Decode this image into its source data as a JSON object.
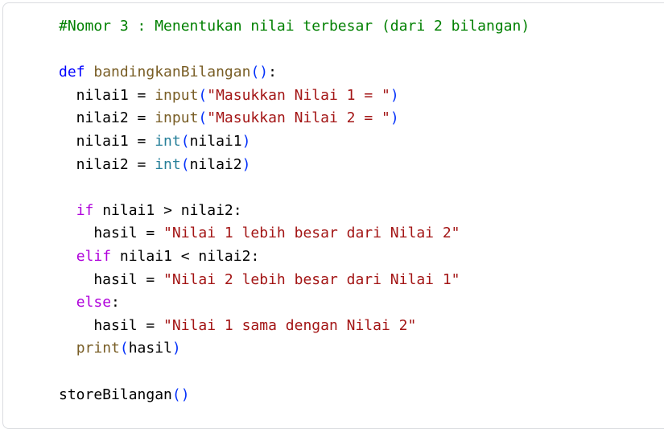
{
  "colors": {
    "comment": "#008000",
    "keyword_def": "#0000ff",
    "keyword_control": "#af00db",
    "function": "#795e26",
    "builtin_type": "#267f99",
    "string": "#a31515",
    "bracket": "#0431fa",
    "text": "#000000",
    "panel_border": "#dadce0"
  },
  "code": {
    "language": "python",
    "lines": [
      {
        "tokens": [
          {
            "t": "#Nomor 3 : Menentukan nilai terbesar (dari 2 bilangan)",
            "k": "comment"
          }
        ]
      },
      {
        "tokens": []
      },
      {
        "tokens": [
          {
            "t": "def",
            "k": "kw1"
          },
          {
            "t": " ",
            "k": "op"
          },
          {
            "t": "bandingkanBilangan",
            "k": "fn"
          },
          {
            "t": "()",
            "k": "br"
          },
          {
            "t": ":",
            "k": "op"
          }
        ]
      },
      {
        "tokens": [
          {
            "t": "  nilai1 = ",
            "k": "op"
          },
          {
            "t": "input",
            "k": "fn"
          },
          {
            "t": "(",
            "k": "br"
          },
          {
            "t": "\"Masukkan Nilai 1 = \"",
            "k": "str"
          },
          {
            "t": ")",
            "k": "br"
          }
        ]
      },
      {
        "tokens": [
          {
            "t": "  nilai2 = ",
            "k": "op"
          },
          {
            "t": "input",
            "k": "fn"
          },
          {
            "t": "(",
            "k": "br"
          },
          {
            "t": "\"Masukkan Nilai 2 = \"",
            "k": "str"
          },
          {
            "t": ")",
            "k": "br"
          }
        ]
      },
      {
        "tokens": [
          {
            "t": "  nilai1 = ",
            "k": "op"
          },
          {
            "t": "int",
            "k": "bi"
          },
          {
            "t": "(",
            "k": "br"
          },
          {
            "t": "nilai1",
            "k": "op"
          },
          {
            "t": ")",
            "k": "br"
          }
        ]
      },
      {
        "tokens": [
          {
            "t": "  nilai2 = ",
            "k": "op"
          },
          {
            "t": "int",
            "k": "bi"
          },
          {
            "t": "(",
            "k": "br"
          },
          {
            "t": "nilai2",
            "k": "op"
          },
          {
            "t": ")",
            "k": "br"
          }
        ]
      },
      {
        "tokens": []
      },
      {
        "tokens": [
          {
            "t": "  ",
            "k": "op"
          },
          {
            "t": "if",
            "k": "kw2"
          },
          {
            "t": " nilai1 > nilai2:",
            "k": "op"
          }
        ]
      },
      {
        "tokens": [
          {
            "t": "    hasil = ",
            "k": "op"
          },
          {
            "t": "\"Nilai 1 lebih besar dari Nilai 2\"",
            "k": "str"
          }
        ]
      },
      {
        "tokens": [
          {
            "t": "  ",
            "k": "op"
          },
          {
            "t": "elif",
            "k": "kw2"
          },
          {
            "t": " nilai1 < nilai2:",
            "k": "op"
          }
        ]
      },
      {
        "tokens": [
          {
            "t": "    hasil = ",
            "k": "op"
          },
          {
            "t": "\"Nilai 2 lebih besar dari Nilai 1\"",
            "k": "str"
          }
        ]
      },
      {
        "tokens": [
          {
            "t": "  ",
            "k": "op"
          },
          {
            "t": "else",
            "k": "kw2"
          },
          {
            "t": ":",
            "k": "op"
          }
        ]
      },
      {
        "tokens": [
          {
            "t": "    hasil = ",
            "k": "op"
          },
          {
            "t": "\"Nilai 1 sama dengan Nilai 2\"",
            "k": "str"
          }
        ]
      },
      {
        "tokens": [
          {
            "t": "  ",
            "k": "op"
          },
          {
            "t": "print",
            "k": "fn"
          },
          {
            "t": "(",
            "k": "br"
          },
          {
            "t": "hasil",
            "k": "op"
          },
          {
            "t": ")",
            "k": "br"
          }
        ]
      },
      {
        "tokens": []
      },
      {
        "tokens": [
          {
            "t": "storeBilangan",
            "k": "op"
          },
          {
            "t": "()",
            "k": "br"
          }
        ]
      }
    ]
  }
}
